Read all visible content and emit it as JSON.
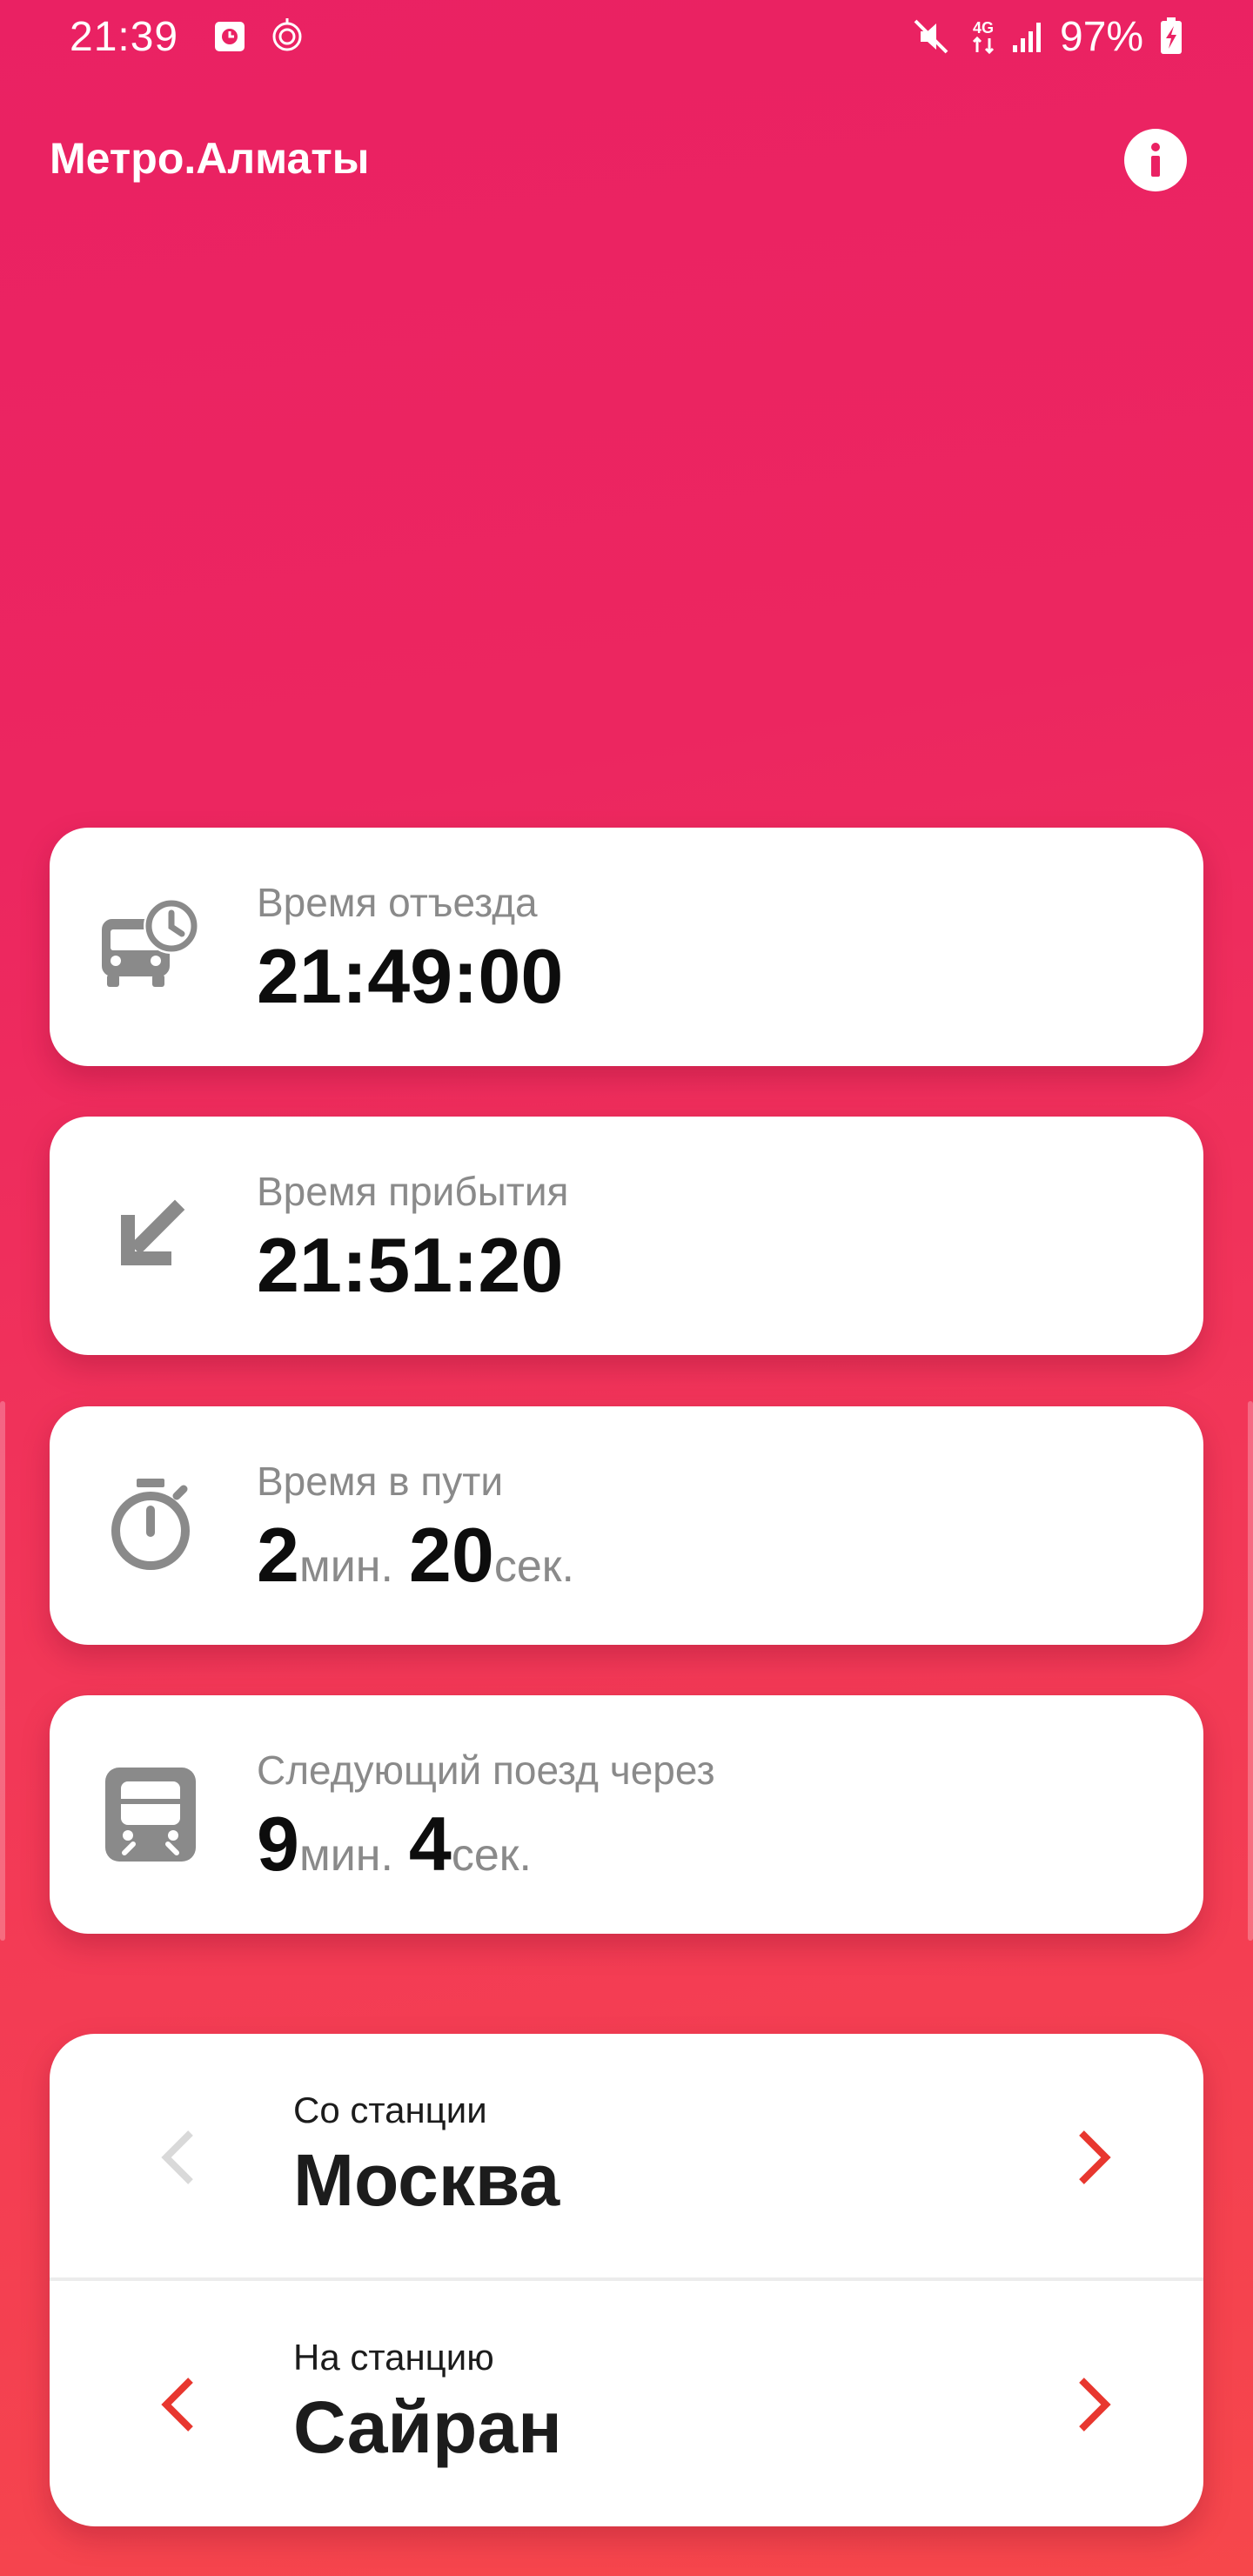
{
  "status_bar": {
    "time": "21:39",
    "battery_percent": "97%",
    "network_label": "4G",
    "icons": [
      "clock-app-icon",
      "notification-icon",
      "mute-icon",
      "network-4g-icon",
      "signal-icon",
      "battery-charging-icon"
    ]
  },
  "header": {
    "title": "Метро.Алматы",
    "info_icon": "info-icon"
  },
  "cards": {
    "departure": {
      "label": "Время отъезда",
      "value": "21:49:00",
      "icon": "bus-clock-icon"
    },
    "arrival": {
      "label": "Время прибытия",
      "value": "21:51:20",
      "icon": "arrow-down-left-icon"
    },
    "travel": {
      "label": "Время в пути",
      "minutes": "2",
      "minutes_unit": "мин.",
      "seconds": "20",
      "seconds_unit": "сек.",
      "icon": "stopwatch-icon"
    },
    "next_train": {
      "label": "Следующий поезд через",
      "minutes": "9",
      "minutes_unit": "мин.",
      "seconds": "4",
      "seconds_unit": "сек.",
      "icon": "train-icon"
    }
  },
  "stations": {
    "from": {
      "label": "Со станции",
      "name": "Москва",
      "prev_enabled": false,
      "next_enabled": true
    },
    "to": {
      "label": "На станцию",
      "name": "Сайран",
      "prev_enabled": true,
      "next_enabled": true
    }
  },
  "colors": {
    "gradient_top": "#ea2163",
    "gradient_bottom": "#f6474b",
    "chevron_active": "#e8372f",
    "chevron_disabled": "#d9d9d9",
    "icon_gray": "#8a8a8a"
  }
}
